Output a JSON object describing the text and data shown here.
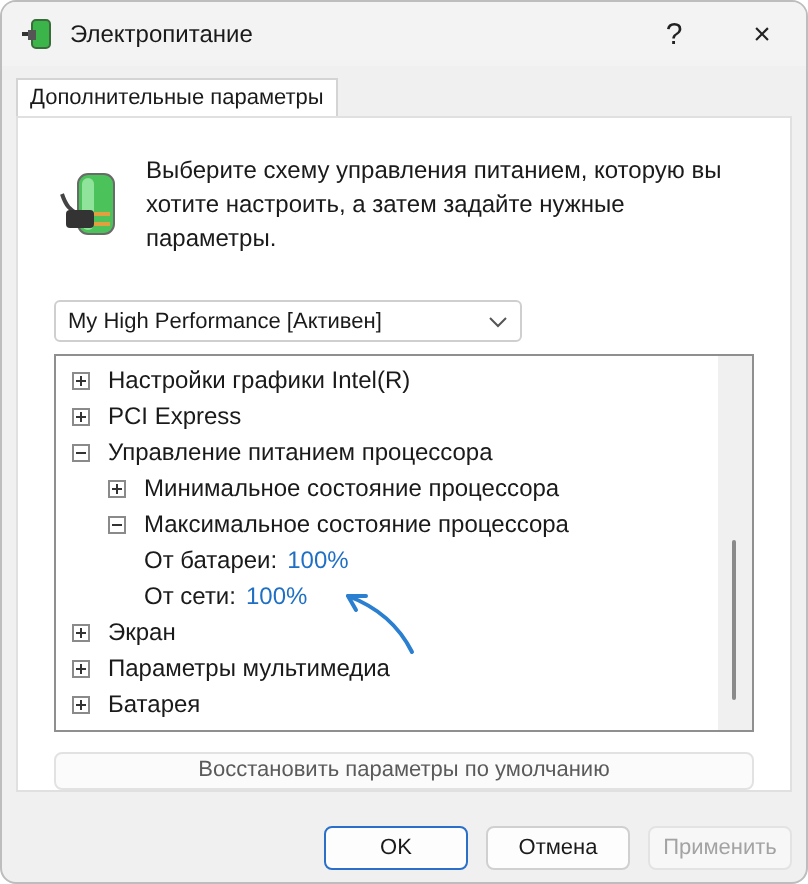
{
  "window": {
    "title": "Электропитание",
    "help": "?",
    "close": "×"
  },
  "tabs": [
    {
      "label": "Дополнительные параметры",
      "selected": true
    }
  ],
  "description": "Выберите схему управления питанием, которую вы хотите настроить, а затем задайте нужные параметры.",
  "plan_dropdown": {
    "value": "My High Performance [Активен]"
  },
  "tree": [
    {
      "kind": "group",
      "label": "Настройки графики Intel(R)",
      "expanded": false
    },
    {
      "kind": "group",
      "label": "PCI Express",
      "expanded": false
    },
    {
      "kind": "group",
      "label": "Управление питанием процессора",
      "expanded": true,
      "children": [
        {
          "kind": "group",
          "label": "Минимальное состояние процессора",
          "expanded": false
        },
        {
          "kind": "group",
          "label": "Максимальное состояние процессора",
          "expanded": true,
          "children": [
            {
              "kind": "setting",
              "label": "От батареи:",
              "value": "100%"
            },
            {
              "kind": "setting",
              "label": "От сети:",
              "value": "100%"
            }
          ]
        }
      ]
    },
    {
      "kind": "group",
      "label": "Экран",
      "expanded": false
    },
    {
      "kind": "group",
      "label": "Параметры мультимедиа",
      "expanded": false
    },
    {
      "kind": "group",
      "label": "Батарея",
      "expanded": false
    }
  ],
  "restore_button": {
    "label": "Восстановить параметры по умолчанию",
    "disabled": false
  },
  "buttons": [
    {
      "label": "OK",
      "kind": "default",
      "disabled": false
    },
    {
      "label": "Отмена",
      "kind": "normal",
      "disabled": false
    },
    {
      "label": "Применить",
      "kind": "normal",
      "disabled": true
    }
  ]
}
